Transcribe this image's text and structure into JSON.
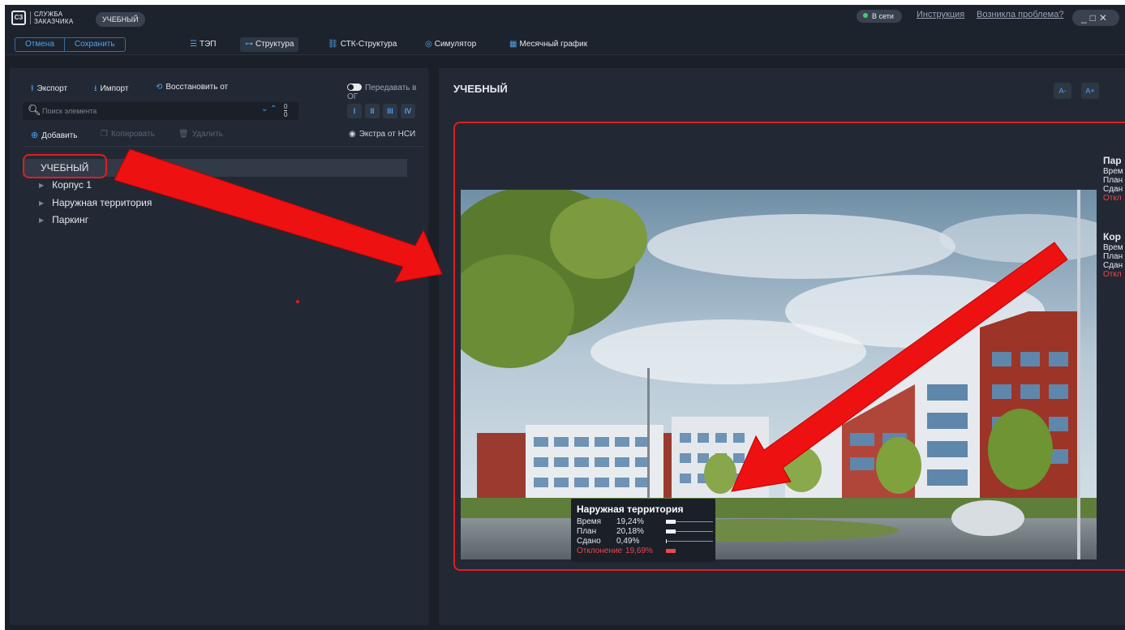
{
  "window": {
    "logo_mark": "СЗ",
    "logo_line1": "СЛУЖБА",
    "logo_line2": "ЗАКАЗЧИКА",
    "project_pill": "УЧЕБНЫЙ",
    "status": "В сети",
    "link_instruction": "Инструкция",
    "link_problem": "Возникла проблема?",
    "controls": "_□✕"
  },
  "toolbar": {
    "cancel": "Отмена",
    "save": "Сохранить",
    "tabs": [
      {
        "label": "ТЭП",
        "icon": "list-icon"
      },
      {
        "label": "Структура",
        "icon": "structure-icon",
        "active": true
      },
      {
        "label": "СТК-Структура",
        "icon": "link-icon"
      },
      {
        "label": "Симулятор",
        "icon": "simulator-icon"
      },
      {
        "label": "Месячный график",
        "icon": "calendar-icon"
      }
    ]
  },
  "left": {
    "export": "Экспорт",
    "import": "Импорт",
    "restore": "Восстановить от",
    "transfer_toggle": "Передавать в ОГ",
    "search_placeholder": "Поиск элемента",
    "search_count_top": "0",
    "search_count_bottom": "0",
    "levels": [
      "I",
      "II",
      "III",
      "IV"
    ],
    "add": "Добавить",
    "copy": "Копировать",
    "delete": "Удалить",
    "extra": "Экстра от НСИ",
    "tree": {
      "root": "УЧЕБНЫЙ",
      "children": [
        "Корпус 1",
        "Наружная территория",
        "Паркинг"
      ]
    }
  },
  "right": {
    "title": "УЧЕБНЫЙ",
    "font_smaller": "A-",
    "font_larger": "A+",
    "card": {
      "title": "Наружная территория",
      "rows": [
        {
          "label": "Время",
          "value": "19,24%",
          "fraction": 0.1924
        },
        {
          "label": "План",
          "value": "20,18%",
          "fraction": 0.2018
        },
        {
          "label": "Сдано",
          "value": "0,49%",
          "fraction": 0.0049
        },
        {
          "label": "Отклонение",
          "value": "19,69%",
          "fraction": 0.1969
        }
      ]
    },
    "side_cards": [
      {
        "title": "Пар",
        "lines": [
          "Врем",
          "План",
          "Сдан"
        ],
        "red": "Откл"
      },
      {
        "title": "Кор",
        "lines": [
          "Врем",
          "План",
          "Сдан"
        ],
        "red": "Откл"
      }
    ]
  },
  "colors": {
    "accent": "#4ea3f0",
    "danger": "#e8484f",
    "annotation": "#e01e1e",
    "panel_bg": "#222935",
    "app_bg": "#1a1f28"
  }
}
